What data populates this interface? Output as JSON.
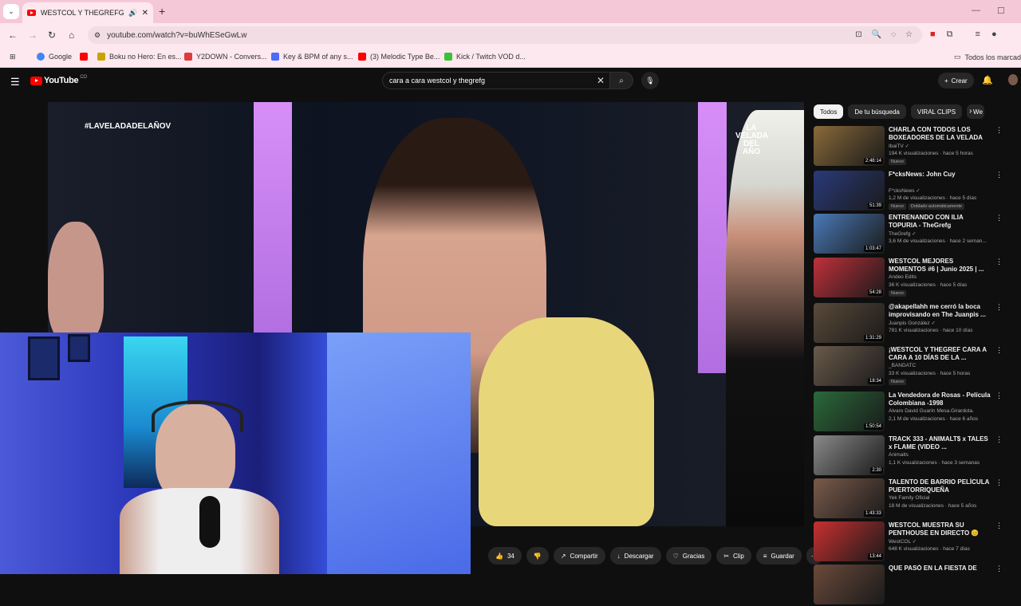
{
  "browser": {
    "tab_title": "WESTCOL Y THEGREFG CAR",
    "url": "youtube.com/watch?v=buWhESeGwLw",
    "bookmarks": [
      {
        "label": "Google",
        "color": "#4285f4"
      },
      {
        "label": "",
        "color": "#ff0000"
      },
      {
        "label": "Boku no Hero: En es...",
        "color": "#c8a400"
      },
      {
        "label": "Y2DOWN - Convers...",
        "color": "#e03a3a"
      },
      {
        "label": "Key & BPM of any s...",
        "color": "#4a6cf7"
      },
      {
        "label": "(3) Melodic Type Be...",
        "color": "#ff0000"
      },
      {
        "label": "Kick / Twitch VOD d...",
        "color": "#3ac03a"
      }
    ],
    "all_bookmarks": "Todos los marcad"
  },
  "youtube": {
    "logo_text": "YouTube",
    "logo_region": "CO",
    "search_query": "cara a cara westcol y thegrefg",
    "create_label": "Crear"
  },
  "video": {
    "hashtag": "#LAVELADADELAÑOV",
    "corner_logo": "LA VELADA DEL AÑO"
  },
  "actions": [
    {
      "name": "like-button",
      "icon": "👍",
      "label": "34"
    },
    {
      "name": "dislike-button",
      "icon": "👎",
      "label": ""
    },
    {
      "name": "share-button",
      "icon": "↗",
      "label": "Compartir"
    },
    {
      "name": "download-button",
      "icon": "↓",
      "label": "Descargar"
    },
    {
      "name": "thanks-button",
      "icon": "♡",
      "label": "Gracias"
    },
    {
      "name": "clip-button",
      "icon": "✂",
      "label": "Clip"
    },
    {
      "name": "save-button",
      "icon": "≡",
      "label": "Guardar"
    },
    {
      "name": "more-button",
      "icon": "⋯",
      "label": ""
    }
  ],
  "chips": [
    "Todos",
    "De tu búsqueda",
    "VIRAL CLIPS",
    "We"
  ],
  "recommendations": [
    {
      "title": "CHARLA CON TODOS LOS BOXEADORES DE LA VELADA",
      "channel": "IbaiTV ✓",
      "meta": "194 K visualizaciones · hace 5 horas",
      "badges": [
        "Nuevo"
      ],
      "duration": "2:48:14",
      "color": "#8a6a3a"
    },
    {
      "title": "F*cksNews: John Cuy",
      "channel": "F*cksNews ✓",
      "meta": "1,2 M de visualizaciones · hace 5 días",
      "badges": [
        "Nuevo",
        "Doblado automáticamente"
      ],
      "duration": "51:39",
      "color": "#2a3a7a"
    },
    {
      "title": "ENTRENANDO CON ILIA TOPURIA - TheGrefg",
      "channel": "TheGrefg ✓",
      "meta": "3,6 M de visualizaciones · hace 2 seman...",
      "badges": [],
      "duration": "1:03:47",
      "color": "#4a7ab8"
    },
    {
      "title": "WESTCOL MEJORES MOMENTOS #6 | Junio 2025 | ...",
      "channel": "Andeo Edits",
      "meta": "36 K visualizaciones · hace 5 días",
      "badges": [
        "Nuevo"
      ],
      "duration": "54:28",
      "color": "#c0303a"
    },
    {
      "title": "@akapellahh me cerró la boca improvisando en The Juanpis ...",
      "channel": "Juanpis González ✓",
      "meta": "781 K visualizaciones · hace 10 días",
      "badges": [],
      "duration": "1:31:29",
      "color": "#5a4a3a"
    },
    {
      "title": "¡WESTCOL Y THEGREF CARA A CARA A 10 DÍAS DE LA ...",
      "channel": "_BANDATC",
      "meta": "33 K visualizaciones · hace 5 horas",
      "badges": [
        "Nuevo"
      ],
      "duration": "18:34",
      "color": "#6a5a4a"
    },
    {
      "title": "La Vendedora de Rosas - Película Colombiana -1998",
      "channel": "Alvaro David Guarín Mesa.Girardota.",
      "meta": "2,1 M de visualizaciones · hace 6 años",
      "badges": [],
      "duration": "1:50:54",
      "color": "#2a6a3a"
    },
    {
      "title": "TRACK 333 - ANIMALT$ x TALES x FLAME (VIDEO ...",
      "channel": "Animalts",
      "meta": "1,1 K visualizaciones · hace 3 semanas",
      "badges": [],
      "duration": "2:30",
      "color": "#8a8a8a"
    },
    {
      "title": "TALENTO DE BARRIO PELÍCULA PUERTORRIQUEÑA",
      "channel": "Yek Family Oficial",
      "meta": "18 M de visualizaciones · hace 5 años",
      "badges": [],
      "duration": "1:43:33",
      "color": "#7a5a4a"
    },
    {
      "title": "WESTCOL MUESTRA SU PENTHOUSE EN DIRECTO 😊",
      "channel": "WestCOL ✓",
      "meta": "648 K visualizaciones · hace 7 días",
      "badges": [],
      "duration": "13:44",
      "color": "#c83030"
    },
    {
      "title": "QUE PASÓ EN LA FIESTA DE",
      "channel": "",
      "meta": "",
      "badges": [],
      "duration": "",
      "color": "#6a4a3a"
    }
  ]
}
